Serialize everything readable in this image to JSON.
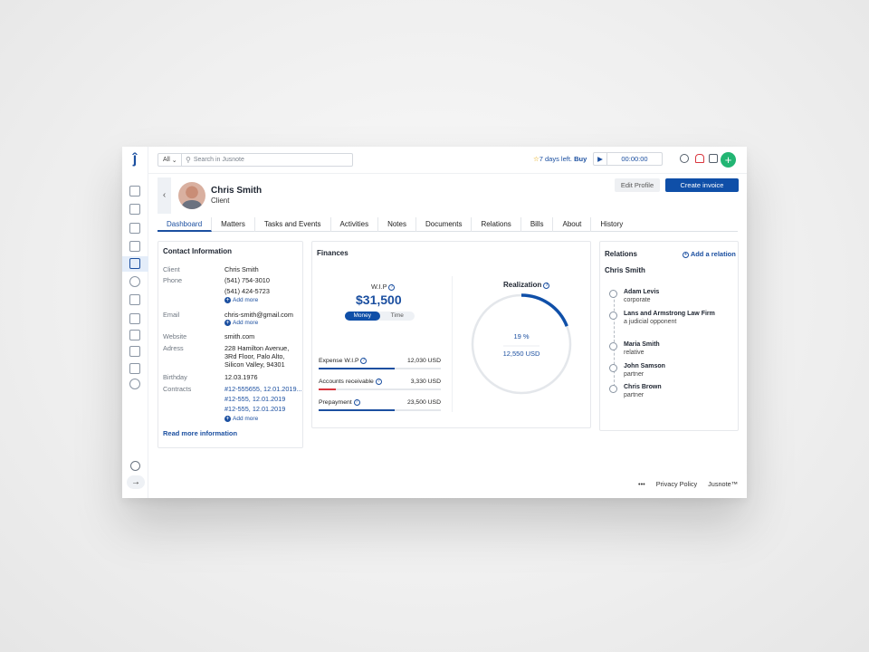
{
  "search": {
    "scope": "All",
    "placeholder": "Search in Jusnote"
  },
  "trial": {
    "text": "7 days left.",
    "action": "Buy"
  },
  "timer": {
    "value": "00:00:00"
  },
  "header": {
    "name": "Chris Smith",
    "role": "Client",
    "edit_label": "Edit Profile",
    "create_label": "Create invoice"
  },
  "tabs": [
    "Dashboard",
    "Matters",
    "Tasks and Events",
    "Activities",
    "Notes",
    "Documents",
    "Relations",
    "Bills",
    "About",
    "History"
  ],
  "contact": {
    "title": "Contact Information",
    "client_label": "Client",
    "client_value": "Chris Smith",
    "phone_label": "Phone",
    "phone_1": "(541) 754-3010",
    "phone_2": "(541) 424-5723",
    "add_more": "Add more",
    "email_label": "Email",
    "email_value": "chris-smith@gmail.com",
    "website_label": "Website",
    "website_value": "smith.com",
    "address_label": "Adress",
    "address_1": "228 Hamilton Avenue,",
    "address_2": "3Rd Floor, Palo Alto,",
    "address_3": "Silicon Valley, 94301",
    "birthday_label": "Birthday",
    "birthday_value": "12.03.1976",
    "contracts_label": "Contracts",
    "contract_1": "#12-555655, 12.01.2019...",
    "contract_2": "#12-555, 12.01.2019",
    "contract_3": "#12-555, 12.01.2019",
    "read_more": "Read more information"
  },
  "finances": {
    "title": "Finances",
    "wip_label": "W.I.P",
    "wip_value": "$31,500",
    "toggle_money": "Money",
    "toggle_time": "Time",
    "rows": [
      {
        "label": "Expense W.I.P",
        "value": "12,030 USD",
        "fill": 0.62,
        "color": "#1b4fa0"
      },
      {
        "label": "Accounts receivable",
        "value": "3,330 USD",
        "fill": 0.14,
        "color": "#d9363e"
      },
      {
        "label": "Prepayment",
        "value": "23,500 USD",
        "fill": 0.62,
        "color": "#1b4fa0"
      }
    ],
    "realization_label": "Realization",
    "realization_percent": "19 %",
    "realization_amount": "12,550 USD",
    "realization_fraction": 0.19
  },
  "relations": {
    "title": "Relations",
    "add_label": "Add a relation",
    "main": "Chris Smith",
    "items": [
      {
        "name": "Adam Levis",
        "role": "corporate"
      },
      {
        "name": "Lans and Armstrong Law Firm",
        "role": "a judicial opponent"
      },
      {
        "name": "Maria Smith",
        "role": "relative"
      },
      {
        "name": "John Samson",
        "role": "partner"
      },
      {
        "name": "Chris Brown",
        "role": "partner"
      }
    ]
  },
  "footer": {
    "more": "•••",
    "privacy": "Privacy Policy",
    "brand": "Jusnote™"
  },
  "colors": {
    "accent": "#1b4fa0",
    "primary_button": "#0f4fa8",
    "add_button": "#22b573",
    "alert": "#d9363e"
  }
}
